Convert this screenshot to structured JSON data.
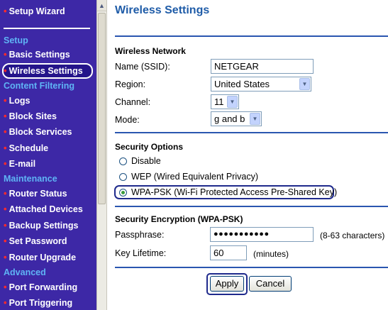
{
  "sidebar": {
    "setup_wizard": "Setup Wizard",
    "headings": {
      "setup": "Setup",
      "content_filtering": "Content Filtering",
      "maintenance": "Maintenance",
      "advanced": "Advanced"
    },
    "items": {
      "basic_settings": "Basic Settings",
      "wireless_settings": "Wireless Settings",
      "logs": "Logs",
      "block_sites": "Block Sites",
      "block_services": "Block Services",
      "schedule": "Schedule",
      "email": "E-mail",
      "router_status": "Router Status",
      "attached_devices": "Attached Devices",
      "backup_settings": "Backup Settings",
      "set_password": "Set Password",
      "router_upgrade": "Router Upgrade",
      "port_forwarding": "Port Forwarding",
      "port_triggering": "Port Triggering"
    },
    "bullet": "•",
    "selected_item": "wireless_settings"
  },
  "scrollbar": {
    "up_arrow": "▲"
  },
  "page": {
    "title": "Wireless Settings"
  },
  "wireless_network": {
    "heading": "Wireless Network",
    "ssid_label": "Name (SSID):",
    "ssid_value": "NETGEAR",
    "region_label": "Region:",
    "region_value": "United States",
    "channel_label": "Channel:",
    "channel_value": "11",
    "mode_label": "Mode:",
    "mode_value": "g and b",
    "dropdown_arrow": "▼"
  },
  "security_options": {
    "heading": "Security Options",
    "options": {
      "disable": "Disable",
      "wep": "WEP (Wired Equivalent Privacy)",
      "wpa_psk": "WPA-PSK (Wi-Fi Protected Access Pre-Shared Key)"
    },
    "selected": "wpa_psk"
  },
  "encryption": {
    "heading": "Security Encryption (WPA-PSK)",
    "passphrase_label": "Passphrase:",
    "passphrase_value": "●●●●●●●●●●●",
    "passphrase_hint": "(8-63 characters)",
    "key_lifetime_label": "Key Lifetime:",
    "key_lifetime_value": "60",
    "key_lifetime_unit": "(minutes)"
  },
  "buttons": {
    "apply": "Apply",
    "cancel": "Cancel"
  },
  "colors": {
    "sidebar_bg": "#3d28a6",
    "sidebar_heading": "#5fb4f5",
    "bullet": "#ff2a2a",
    "title_blue": "#1f5ca8",
    "rule_blue": "#2a56b0"
  }
}
